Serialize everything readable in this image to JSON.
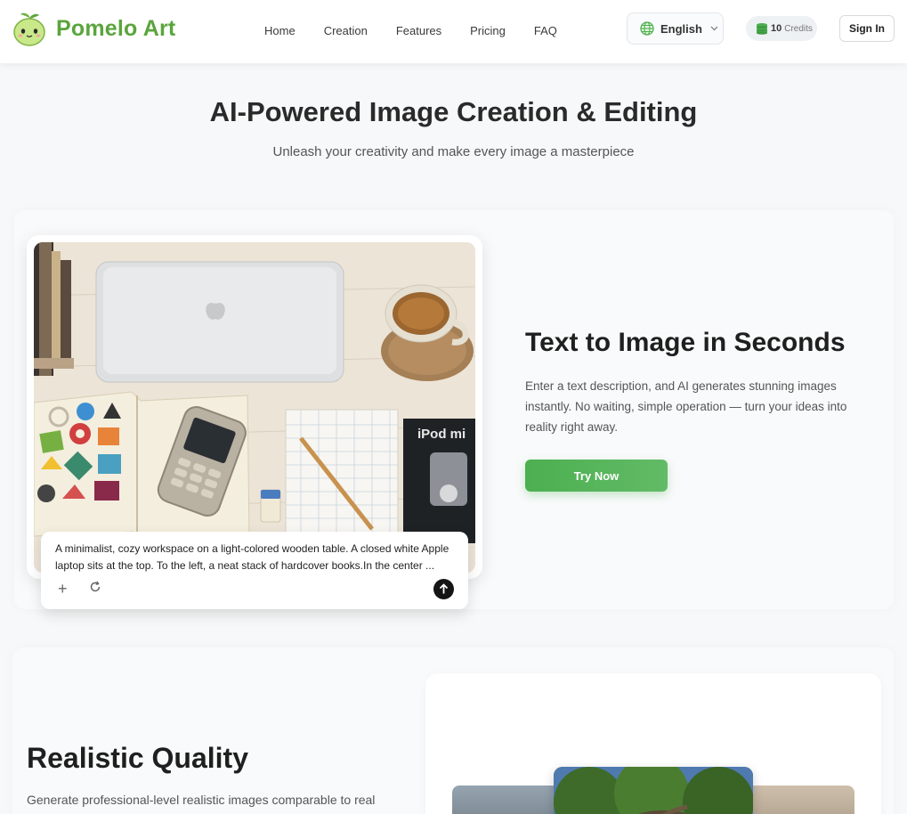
{
  "brand": {
    "name": "Pomelo Art",
    "color": "#5aa53c"
  },
  "nav": {
    "links": [
      "Home",
      "Creation",
      "Features",
      "Pricing",
      "FAQ"
    ],
    "language": "English",
    "credits_count": "10",
    "credits_label": "Credits",
    "signin_label": "Sign In"
  },
  "hero": {
    "title": "AI-Powered Image Creation & Editing",
    "subtitle": "Unleash your creativity and make every image a masterpiece"
  },
  "feature1": {
    "title": "Text to Image in Seconds",
    "description": "Enter a text description, and AI generates stunning images instantly. No waiting, simple operation — turn your ideas into reality right away.",
    "button": "Try Now",
    "prompt": "A minimalist, cozy workspace on a light-colored wooden table. A closed white Apple laptop sits at the top. To the left, a neat stack of hardcover books.In the center ...",
    "photo_text": "iPod mi"
  },
  "feature2": {
    "title": "Realistic Quality",
    "description": "Generate professional-level realistic images comparable to real"
  },
  "colors": {
    "accent": "#4caf50",
    "background": "#f7f8f9"
  }
}
